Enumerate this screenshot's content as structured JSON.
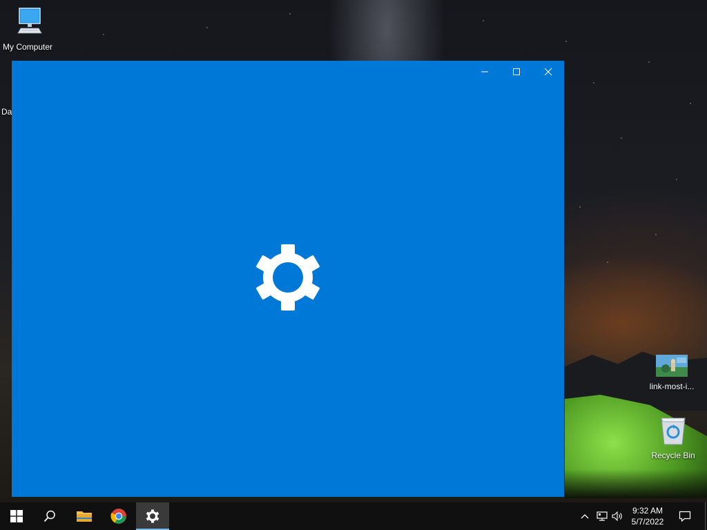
{
  "desktop": {
    "icons": [
      {
        "label": "My Computer",
        "icon": "computer-icon"
      },
      {
        "label": "link-most-i...",
        "icon": "image-thumbnail-icon"
      },
      {
        "label": "Recycle Bin",
        "icon": "recycle-bin-icon"
      }
    ],
    "partial_icon_label": "Da"
  },
  "window": {
    "background_color": "#0078d7",
    "controls": {
      "minimize": "minimize-icon",
      "maximize": "maximize-icon",
      "close": "close-icon"
    },
    "splash_icon": "gear-icon"
  },
  "taskbar": {
    "buttons": [
      {
        "name": "start",
        "icon": "windows-logo-icon"
      },
      {
        "name": "search",
        "icon": "search-icon"
      },
      {
        "name": "file-explorer",
        "icon": "folder-icon"
      },
      {
        "name": "chrome",
        "icon": "chrome-icon"
      },
      {
        "name": "settings",
        "icon": "gear-icon",
        "active": true
      }
    ],
    "tray": {
      "icons": [
        "chevron-up-icon",
        "network-icon",
        "volume-icon"
      ],
      "time": "9:32 AM",
      "date": "5/7/2022",
      "notification_icon": "action-center-icon"
    },
    "accent_color": "#76b9ed"
  }
}
